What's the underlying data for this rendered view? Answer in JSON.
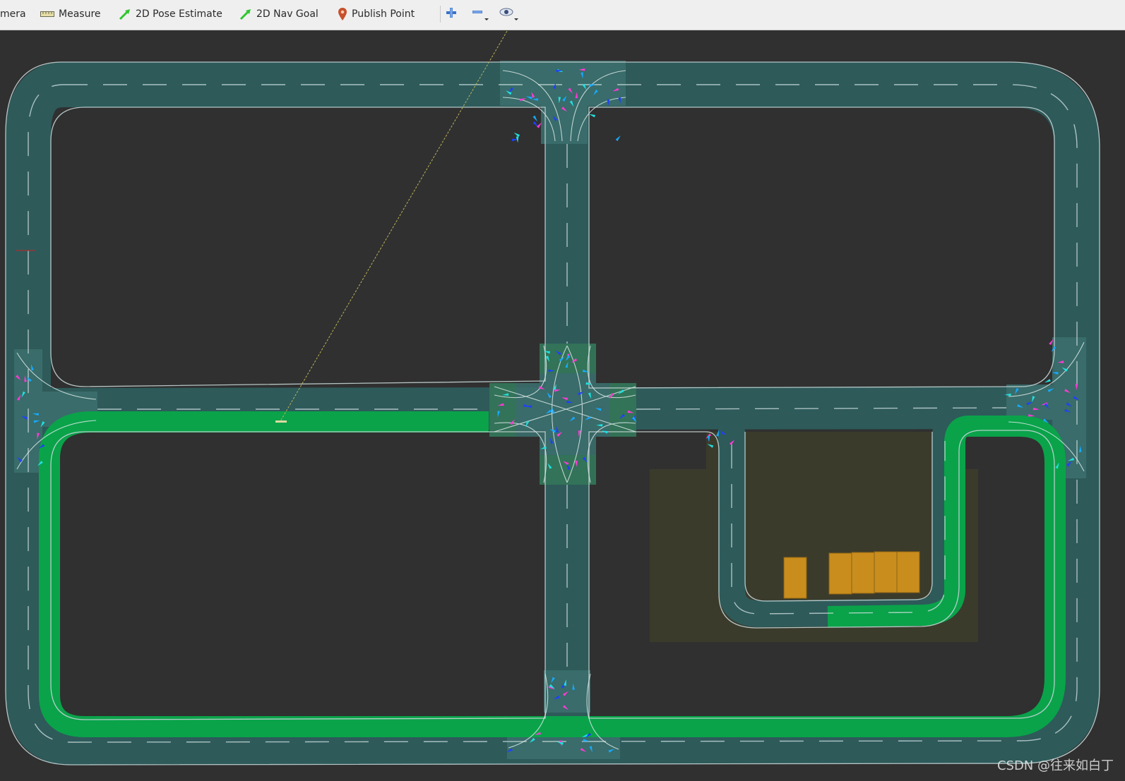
{
  "toolbar": {
    "camera_label": "mera",
    "measure_label": "Measure",
    "pose_label": "2D Pose Estimate",
    "nav_label": "2D Nav Goal",
    "publish_label": "Publish Point",
    "icons": [
      "ruler-icon",
      "pose-arrow-icon",
      "nav-arrow-icon",
      "map-pin-icon",
      "zoom-in-icon",
      "zoom-out-icon",
      "eye-icon"
    ],
    "colors": {
      "pose_arrow": "#2fc52f",
      "nav_arrow": "#2fc52f",
      "pin": "#c8502a",
      "plus": "#3a72c8"
    }
  },
  "map": {
    "colors": {
      "background": "#303030",
      "road": "#2e5a5a",
      "road_edge": "#bfcfcf",
      "lane_mark": "#cfdede",
      "path": "#0aa34a",
      "parking_area": "#3b3b2c",
      "vehicles": "#c98d1d",
      "intersection_marks": [
        "#ff3bd4",
        "#17a9ff",
        "#20e0e0",
        "#1e40ff"
      ]
    }
  },
  "watermark": "CSDN @往来如白丁"
}
